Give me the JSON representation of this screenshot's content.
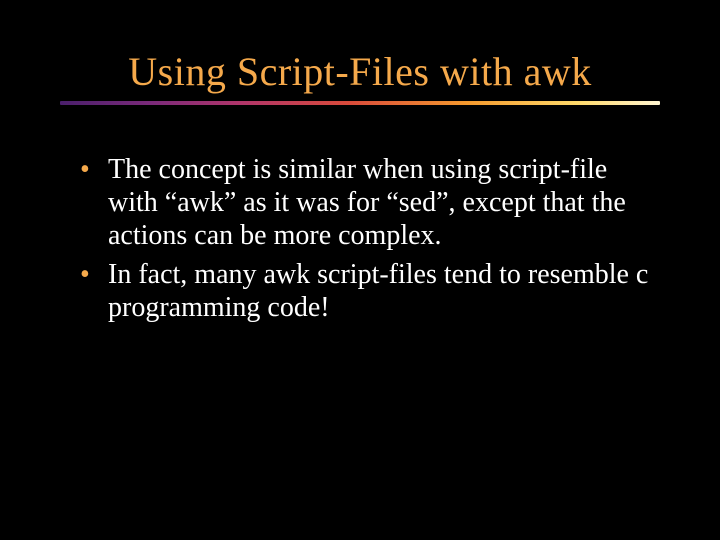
{
  "slide": {
    "title": "Using Script-Files with awk",
    "bullets": [
      "The concept is similar when using script-file with “awk” as it was for “sed”, except that the actions can be more complex.",
      "In fact, many awk script-files tend to resemble c programming code!"
    ]
  }
}
